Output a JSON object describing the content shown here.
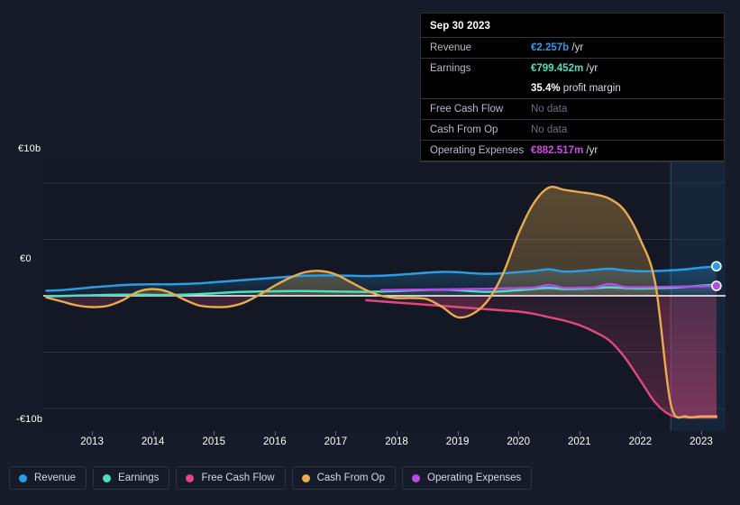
{
  "theme": {
    "background": "#151b28",
    "plot_background": "#131824",
    "gridline": "#2c3546",
    "zero_line": "#ffffff",
    "axis_text": "#ffffff",
    "forecast_band": "#17283c"
  },
  "axes": {
    "y_labels": [
      "€10b",
      "€0",
      "-€10b"
    ],
    "y_ticks": [
      10,
      5,
      0,
      -5,
      -10
    ],
    "y_unit": "€b",
    "x_labels": [
      "2013",
      "2014",
      "2015",
      "2016",
      "2017",
      "2018",
      "2019",
      "2020",
      "2021",
      "2022",
      "2023"
    ]
  },
  "tooltip": {
    "date": "Sep 30 2023",
    "rows": [
      {
        "label": "Revenue",
        "value": "€2.257b",
        "unit": "/yr",
        "color": "#2e9ce5",
        "no_data": false
      },
      {
        "label": "Earnings",
        "value": "€799.452m",
        "unit": "/yr",
        "color": "#4ce0c0",
        "no_data": false
      },
      {
        "label": "",
        "value": "35.4%",
        "unit": "profit margin",
        "color": "#ffffff",
        "no_data": false
      },
      {
        "label": "Free Cash Flow",
        "value": "No data",
        "unit": "",
        "color": "#6a7180",
        "no_data": true
      },
      {
        "label": "Cash From Op",
        "value": "No data",
        "unit": "",
        "color": "#6a7180",
        "no_data": true
      },
      {
        "label": "Operating Expenses",
        "value": "€882.517m",
        "unit": "/yr",
        "color": "#cc4ce8",
        "no_data": false
      }
    ]
  },
  "legend": {
    "items": [
      {
        "label": "Revenue",
        "color": "#2e9ce5"
      },
      {
        "label": "Earnings",
        "color": "#4ce0c0"
      },
      {
        "label": "Free Cash Flow",
        "color": "#e0487f"
      },
      {
        "label": "Cash From Op",
        "color": "#e8ab4e"
      },
      {
        "label": "Operating Expenses",
        "color": "#b44ce8"
      }
    ]
  },
  "chart_data": {
    "type": "area",
    "title": "",
    "xlabel": "",
    "ylabel": "",
    "ylim": [
      -12,
      12
    ],
    "xlim": [
      2012.7,
      2023.9
    ],
    "grid": true,
    "legend_position": "bottom",
    "currency": "EUR",
    "y_axis_unit": "billions",
    "annotations": {
      "forecast_band_start": 2023.0,
      "zero_line": 0
    },
    "x": [
      2012.75,
      2013.0,
      2013.25,
      2013.5,
      2013.75,
      2014.0,
      2014.25,
      2014.5,
      2014.75,
      2015.0,
      2015.25,
      2015.5,
      2015.75,
      2016.0,
      2016.25,
      2016.5,
      2016.75,
      2017.0,
      2017.25,
      2017.5,
      2017.75,
      2018.0,
      2018.25,
      2018.5,
      2018.75,
      2019.0,
      2019.25,
      2019.5,
      2019.75,
      2020.0,
      2020.25,
      2020.5,
      2020.75,
      2021.0,
      2021.25,
      2021.5,
      2021.75,
      2022.0,
      2022.25,
      2022.5,
      2022.75,
      2023.0,
      2023.25,
      2023.5,
      2023.75
    ],
    "series": [
      {
        "name": "Revenue",
        "color": "#2e9ce5",
        "values": [
          0.45,
          0.5,
          0.62,
          0.75,
          0.85,
          0.95,
          1.0,
          1.02,
          1.02,
          1.05,
          1.1,
          1.2,
          1.3,
          1.4,
          1.5,
          1.6,
          1.7,
          1.78,
          1.8,
          1.8,
          1.78,
          1.75,
          1.78,
          1.85,
          1.95,
          2.05,
          2.12,
          2.1,
          2.0,
          1.95,
          2.0,
          2.1,
          2.2,
          2.35,
          2.15,
          2.2,
          2.3,
          2.4,
          2.25,
          2.18,
          2.2,
          2.26,
          2.35,
          2.5,
          2.62
        ]
      },
      {
        "name": "Earnings",
        "color": "#4ce0c0",
        "values": [
          -0.05,
          -0.02,
          0.02,
          0.05,
          0.08,
          0.1,
          0.1,
          0.08,
          0.08,
          0.1,
          0.15,
          0.22,
          0.3,
          0.35,
          0.38,
          0.4,
          0.42,
          0.42,
          0.4,
          0.38,
          0.36,
          0.35,
          0.38,
          0.42,
          0.48,
          0.52,
          0.55,
          0.5,
          0.4,
          0.35,
          0.4,
          0.5,
          0.6,
          0.7,
          0.6,
          0.62,
          0.68,
          0.75,
          0.68,
          0.65,
          0.68,
          0.72,
          0.8,
          0.9,
          0.98
        ]
      },
      {
        "name": "Free Cash Flow",
        "color": "#e0487f",
        "values": [
          null,
          null,
          null,
          null,
          null,
          null,
          null,
          null,
          null,
          null,
          null,
          null,
          null,
          null,
          null,
          null,
          null,
          null,
          null,
          null,
          null,
          -0.4,
          -0.5,
          -0.6,
          -0.7,
          -0.8,
          -0.9,
          -1.0,
          -1.1,
          -1.2,
          -1.3,
          -1.4,
          -1.6,
          -1.9,
          -2.2,
          -2.6,
          -3.2,
          -4.0,
          -5.5,
          -7.5,
          -9.5,
          -10.6,
          -10.8,
          -10.8,
          -10.8
        ]
      },
      {
        "name": "Cash From Op",
        "color": "#e8ab4e",
        "values": [
          -0.15,
          -0.5,
          -0.85,
          -1.0,
          -0.9,
          -0.4,
          0.35,
          0.6,
          0.35,
          -0.3,
          -0.85,
          -1.0,
          -0.95,
          -0.6,
          0.1,
          0.9,
          1.6,
          2.1,
          2.2,
          1.9,
          1.2,
          0.5,
          0.0,
          -0.2,
          -0.2,
          -0.3,
          -1.0,
          -1.9,
          -1.6,
          -0.4,
          2.0,
          5.5,
          8.2,
          9.6,
          9.4,
          9.2,
          9.0,
          8.6,
          7.5,
          5.0,
          1.0,
          -9.6,
          -10.7,
          -10.7,
          -10.7
        ]
      },
      {
        "name": "Operating Expenses",
        "color": "#b44ce8",
        "values": [
          null,
          null,
          null,
          null,
          null,
          null,
          null,
          null,
          null,
          null,
          null,
          null,
          null,
          null,
          null,
          null,
          null,
          null,
          null,
          null,
          null,
          null,
          0.5,
          0.52,
          0.54,
          0.55,
          0.56,
          0.58,
          0.6,
          0.62,
          0.65,
          0.68,
          0.72,
          0.95,
          0.7,
          0.72,
          0.75,
          1.05,
          0.78,
          0.76,
          0.78,
          0.8,
          0.82,
          0.85,
          0.88
        ]
      }
    ]
  }
}
